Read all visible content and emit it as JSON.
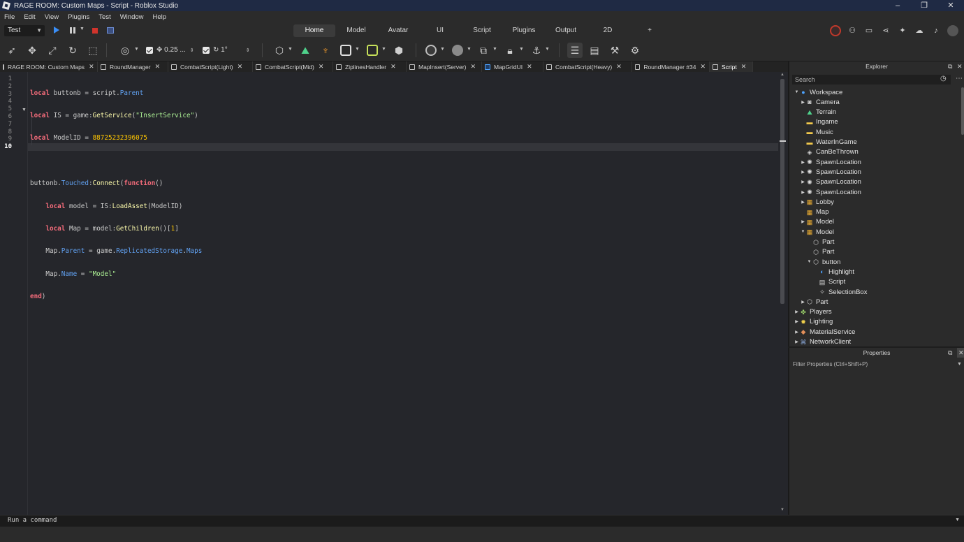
{
  "window": {
    "title": "RAGE ROOM: Custom Maps - Script - Roblox Studio"
  },
  "menu": [
    "File",
    "Edit",
    "View",
    "Plugins",
    "Test",
    "Window",
    "Help"
  ],
  "mode": {
    "place_select": "Test",
    "tabs": [
      "Home",
      "Model",
      "Avatar",
      "UI",
      "Script",
      "Plugins",
      "Output",
      "2D",
      "+"
    ],
    "active_tab": "Home"
  },
  "toolbar": {
    "move_step": "0.25 ...",
    "rotate_step": "1°"
  },
  "script_tabs": [
    {
      "label": "RAGE ROOM: Custom Maps",
      "icon": "place-icon"
    },
    {
      "label": "RoundManager",
      "icon": "script-icon"
    },
    {
      "label": "CombatScript(Light)",
      "icon": "script-icon"
    },
    {
      "label": "CombatScript(Mid)",
      "icon": "script-icon"
    },
    {
      "label": "ZiplinesHandler",
      "icon": "script-icon"
    },
    {
      "label": "MapInsert(Server)",
      "icon": "script-icon"
    },
    {
      "label": "MapGridUI",
      "icon": "localscript-icon"
    },
    {
      "label": "CombatScript(Heavy)",
      "icon": "script-icon"
    },
    {
      "label": "RoundManager #34",
      "icon": "script-icon"
    },
    {
      "label": "Script",
      "icon": "script-icon",
      "active": true
    }
  ],
  "editor": {
    "line_numbers": [
      "1",
      "2",
      "3",
      "4",
      "5",
      "6",
      "7",
      "8",
      "9",
      "10"
    ],
    "current_line": "10",
    "lines": [
      "local buttonb = script.Parent",
      "local IS = game:GetService(\"InsertService\")",
      "local ModelID = 88725232396075",
      "",
      "buttonb.Touched:Connect(function()",
      "    local model = IS:LoadAsset(ModelID)",
      "    local Map = model:GetChildren()[1]",
      "    Map.Parent = game.ReplicatedStorage.Maps",
      "    Map.Name = \"Model\"",
      "end)"
    ]
  },
  "explorer": {
    "title": "Explorer",
    "search_placeholder": "Search",
    "items": [
      {
        "label": "Workspace",
        "icon": "workspace-icon",
        "depth": 0,
        "arrow": "expanded"
      },
      {
        "label": "Camera",
        "icon": "camera-icon",
        "depth": 1,
        "arrow": "collapsed"
      },
      {
        "label": "Terrain",
        "icon": "terrain-icon",
        "depth": 1,
        "arrow": "none"
      },
      {
        "label": "Ingame",
        "icon": "folder-icon",
        "depth": 1,
        "arrow": "none"
      },
      {
        "label": "Music",
        "icon": "folder-icon",
        "depth": 1,
        "arrow": "none"
      },
      {
        "label": "WaterInGame",
        "icon": "folder-icon",
        "depth": 1,
        "arrow": "none"
      },
      {
        "label": "CanBeThrown",
        "icon": "configuration-icon",
        "depth": 1,
        "arrow": "none"
      },
      {
        "label": "SpawnLocation",
        "icon": "spawn-icon",
        "depth": 1,
        "arrow": "collapsed"
      },
      {
        "label": "SpawnLocation",
        "icon": "spawn-icon",
        "depth": 1,
        "arrow": "collapsed"
      },
      {
        "label": "SpawnLocation",
        "icon": "spawn-icon",
        "depth": 1,
        "arrow": "collapsed"
      },
      {
        "label": "SpawnLocation",
        "icon": "spawn-icon",
        "depth": 1,
        "arrow": "collapsed"
      },
      {
        "label": "Lobby",
        "icon": "model-icon",
        "depth": 1,
        "arrow": "collapsed"
      },
      {
        "label": "Map",
        "icon": "model-icon",
        "depth": 1,
        "arrow": "none"
      },
      {
        "label": "Model",
        "icon": "model-icon",
        "depth": 1,
        "arrow": "collapsed"
      },
      {
        "label": "Model",
        "icon": "model-icon",
        "depth": 1,
        "arrow": "expanded"
      },
      {
        "label": "Part",
        "icon": "part-icon",
        "depth": 2,
        "arrow": "none"
      },
      {
        "label": "Part",
        "icon": "part-icon",
        "depth": 2,
        "arrow": "none"
      },
      {
        "label": "button",
        "icon": "part-icon",
        "depth": 2,
        "arrow": "expanded"
      },
      {
        "label": "Highlight",
        "icon": "highlight-icon",
        "depth": 3,
        "arrow": "none"
      },
      {
        "label": "Script",
        "icon": "script-icon",
        "depth": 3,
        "arrow": "none"
      },
      {
        "label": "SelectionBox",
        "icon": "selectionbox-icon",
        "depth": 3,
        "arrow": "none"
      },
      {
        "label": "Part",
        "icon": "part-icon",
        "depth": 1,
        "arrow": "collapsed"
      },
      {
        "label": "Players",
        "icon": "players-icon",
        "depth": 0,
        "arrow": "collapsed"
      },
      {
        "label": "Lighting",
        "icon": "lighting-icon",
        "depth": 0,
        "arrow": "collapsed"
      },
      {
        "label": "MaterialService",
        "icon": "material-icon",
        "depth": 0,
        "arrow": "collapsed"
      },
      {
        "label": "NetworkClient",
        "icon": "network-icon",
        "depth": 0,
        "arrow": "collapsed"
      }
    ]
  },
  "properties": {
    "title": "Properties",
    "filter_placeholder": "Filter Properties (Ctrl+Shift+P)"
  },
  "command_bar": {
    "placeholder": "Run a command"
  },
  "colors": {
    "accent_blue": "#3a8ef6",
    "stop_red": "#d0342c",
    "keyword": "#f86d7c",
    "string": "#adf195",
    "number": "#ffc600",
    "property": "#61a1f1",
    "method": "#fdfbac"
  }
}
